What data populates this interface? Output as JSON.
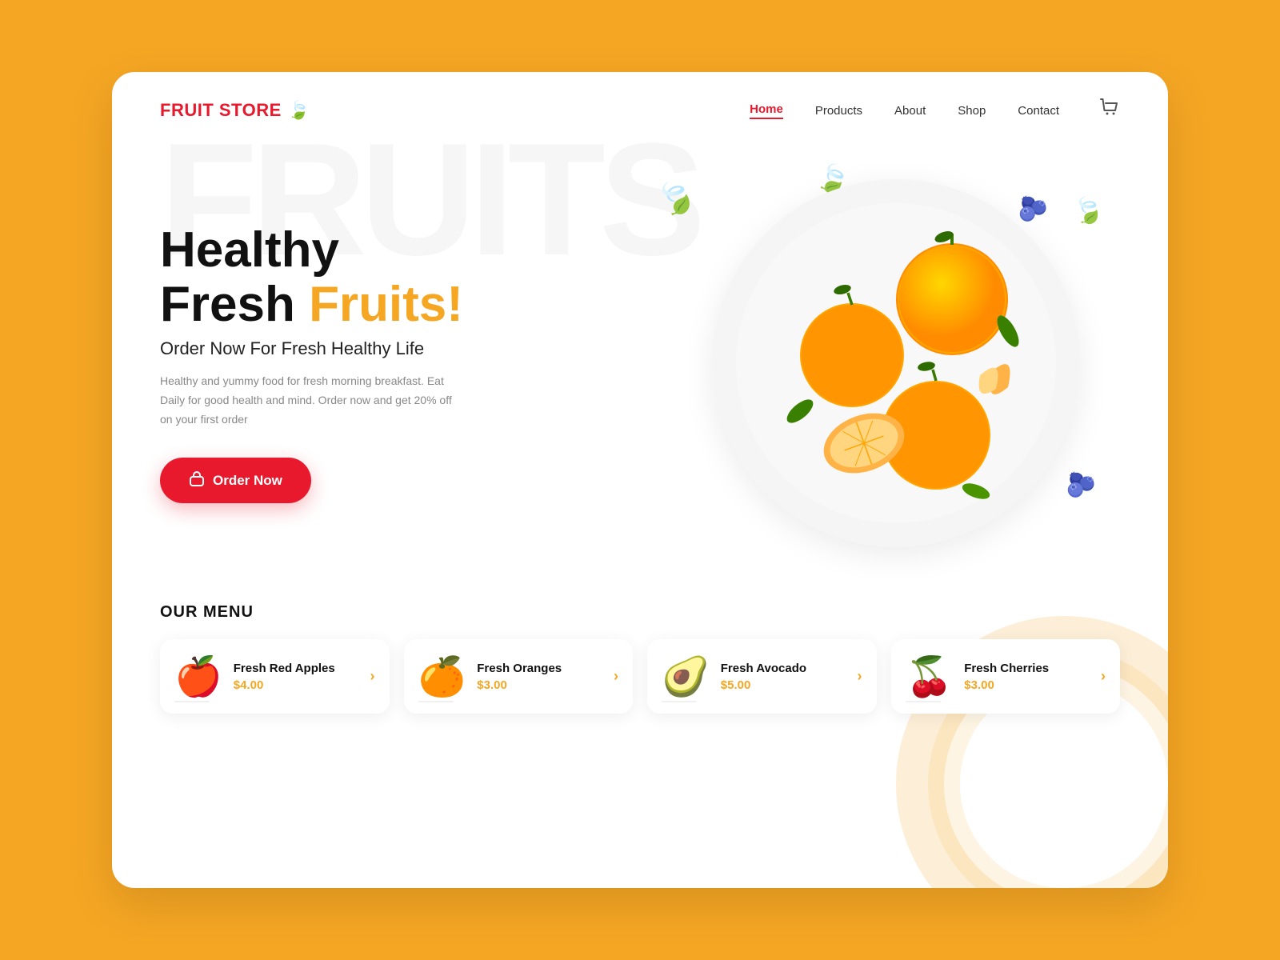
{
  "background_color": "#F5A623",
  "card": {
    "brand": {
      "name": "FRUIT STORE",
      "icon": "🍃"
    },
    "navbar": {
      "links": [
        {
          "label": "Home",
          "active": true
        },
        {
          "label": "Products",
          "active": false
        },
        {
          "label": "About",
          "active": false
        },
        {
          "label": "Shop",
          "active": false
        },
        {
          "label": "Contact",
          "active": false
        }
      ],
      "cart_icon": "🛒"
    },
    "hero": {
      "title_line1": "Healthy",
      "title_line2_plain": "Fresh ",
      "title_line2_highlight": "Fruits!",
      "subtitle": "Order Now For Fresh Healthy Life",
      "description": "Healthy and yummy food for fresh morning breakfast. Eat Daily for good health and mind. Order now and get 20% off on your first order",
      "cta_label": "Order Now",
      "watermark": "FRUITS"
    },
    "menu": {
      "section_title": "OUR MENU",
      "items": [
        {
          "emoji": "🍎",
          "name": "Fresh Red Apples",
          "price": "$4.00"
        },
        {
          "emoji": "🍊",
          "name": "Fresh Oranges",
          "price": "$3.00"
        },
        {
          "emoji": "🥑",
          "name": "Fresh Avocado",
          "price": "$5.00"
        },
        {
          "emoji": "🍒",
          "name": "Fresh Cherries",
          "price": "$3.00"
        }
      ]
    }
  }
}
